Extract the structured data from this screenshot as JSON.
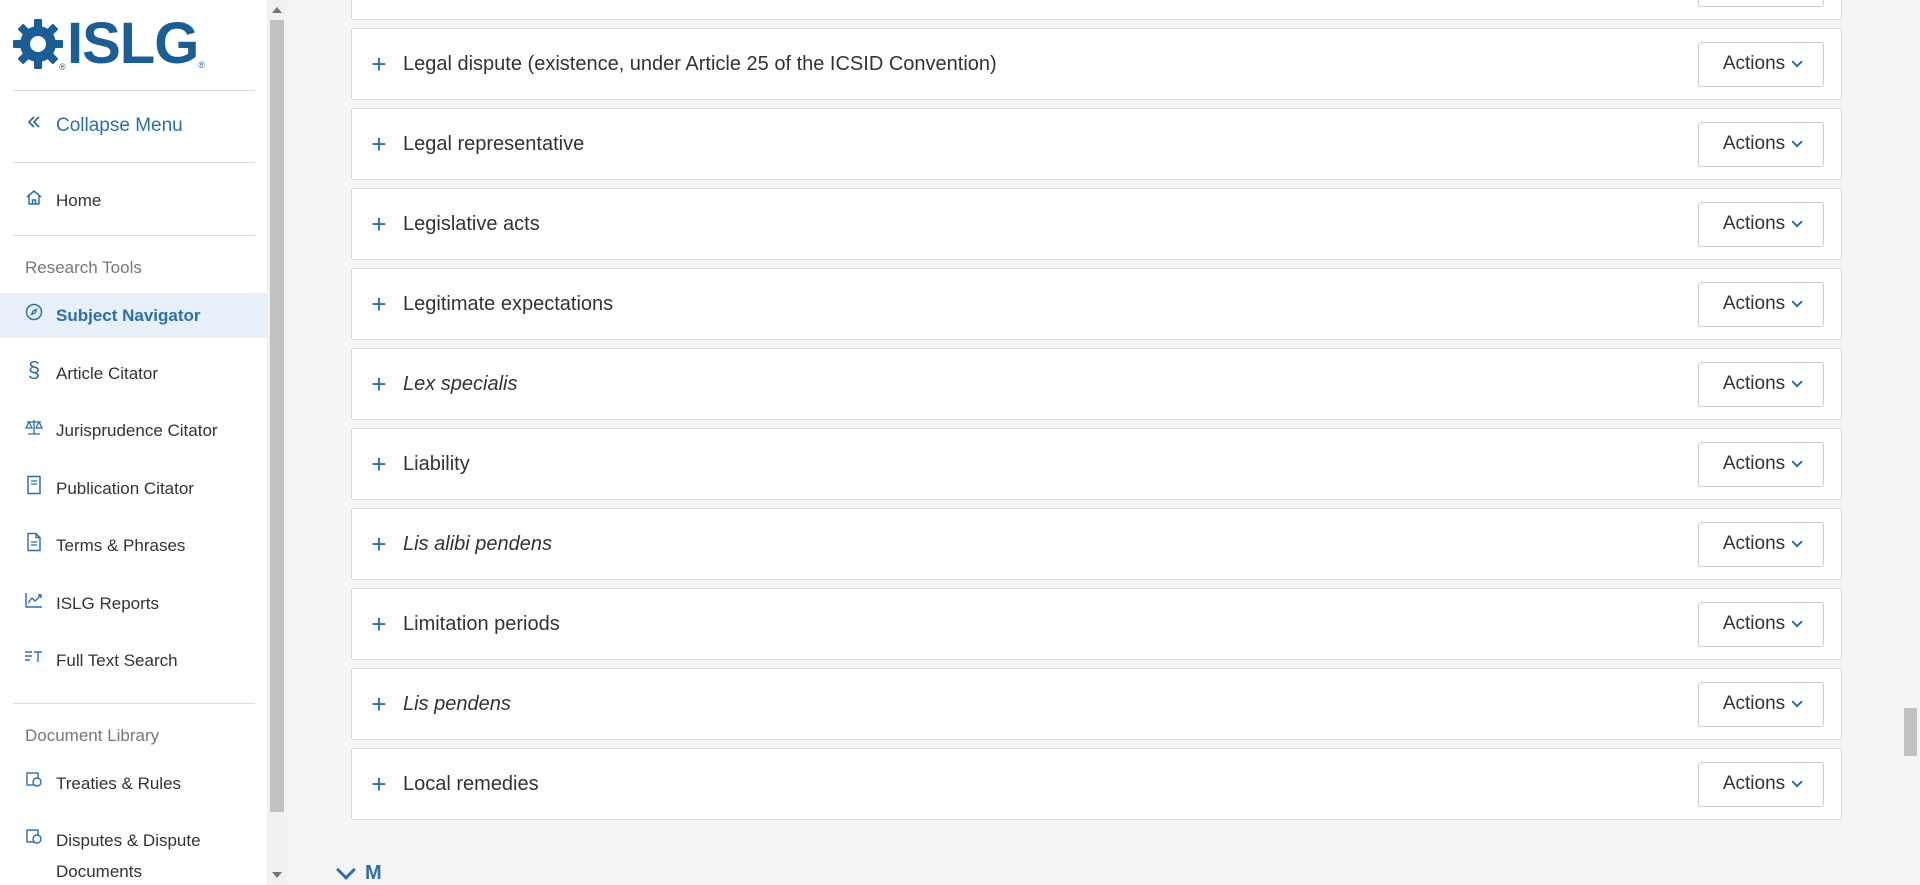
{
  "brand": {
    "name": "ISLG",
    "reg": "®"
  },
  "sidebar": {
    "collapse_label": "Collapse Menu",
    "home_label": "Home",
    "research_tools_heading": "Research Tools",
    "research_tools": [
      {
        "label": "Subject Navigator",
        "icon": "compass-icon",
        "active": true
      },
      {
        "label": "Article Citator",
        "icon": "section-icon",
        "active": false
      },
      {
        "label": "Jurisprudence Citator",
        "icon": "scales-icon",
        "active": false
      },
      {
        "label": "Publication Citator",
        "icon": "book-icon",
        "active": false
      },
      {
        "label": "Terms & Phrases",
        "icon": "document-icon",
        "active": false
      },
      {
        "label": "ISLG Reports",
        "icon": "chart-line-icon",
        "active": false
      },
      {
        "label": "Full Text Search",
        "icon": "text-search-icon",
        "active": false
      }
    ],
    "document_library_heading": "Document Library",
    "document_library": [
      {
        "label": "Treaties & Rules",
        "icon": "treaties-icon"
      },
      {
        "label": "Disputes & Dispute",
        "label2": "Documents",
        "icon": "disputes-icon"
      }
    ]
  },
  "main": {
    "actions_label": "Actions",
    "terms": [
      {
        "label": "Legal dispute (existence, under Article 25 of the ICSID Convention)",
        "italic": false
      },
      {
        "label": "Legal representative",
        "italic": false
      },
      {
        "label": "Legislative acts",
        "italic": false
      },
      {
        "label": "Legitimate expectations",
        "italic": false
      },
      {
        "label": "Lex specialis",
        "italic": true
      },
      {
        "label": "Liability",
        "italic": false
      },
      {
        "label": "Lis alibi pendens",
        "italic": true
      },
      {
        "label": "Limitation periods",
        "italic": false
      },
      {
        "label": "Lis pendens",
        "italic": true
      },
      {
        "label": "Local remedies",
        "italic": false
      }
    ],
    "next_letter": "M"
  },
  "colors": {
    "accent": "#2d6eac",
    "brand": "#1b5e96",
    "active_bg": "#e8f1f9"
  }
}
